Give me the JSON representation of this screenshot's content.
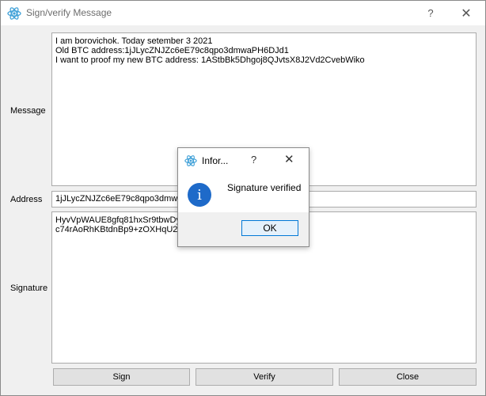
{
  "window": {
    "title": "Sign/verify Message",
    "help_label": "?",
    "close_glyph": "✕"
  },
  "labels": {
    "message": "Message",
    "address": "Address",
    "signature": "Signature"
  },
  "message": {
    "line1": "I am borovichok. Today setember 3 2021",
    "line2": "Old BTC address:1jJLycZNJZc6eE79c8qpo3dmwaPH6DJd1",
    "line3": "I want to proof my new BTC address: 1AStbBk5Dhgoj8QJvtsX8J2Vd2CvebWiko"
  },
  "address": {
    "value": "1jJLycZNJZc6eE79c8qpo3dmwaPH6DJd1"
  },
  "signature": {
    "line1": "HyvVpWAUE8gfq81hxSr9tbwDyG...dKa/",
    "line2": "c74rAoRhKBtdnBp9+zOXHqU2Lv..."
  },
  "buttons": {
    "sign": "Sign",
    "verify": "Verify",
    "close": "Close"
  },
  "dialog": {
    "title": "Infor...",
    "help_label": "?",
    "close_glyph": "✕",
    "text": "Signature verified",
    "info_glyph": "i",
    "ok": "OK"
  },
  "colors": {
    "accent": "#0078d7",
    "info": "#1e6ac9"
  },
  "icons": {
    "app": "qt-atom-icon",
    "info": "info-icon"
  }
}
